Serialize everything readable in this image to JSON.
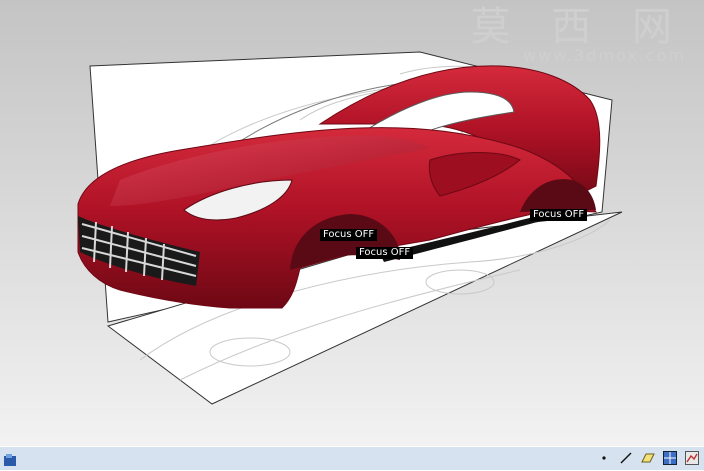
{
  "watermark": {
    "title": "莫 西 网",
    "url": "www.3dmox.com"
  },
  "focus_labels": [
    "Focus OFF",
    "Focus OFF",
    "Focus OFF"
  ],
  "colors": {
    "car_body": "#b01226",
    "background_top": "#c4c4c4",
    "background_bottom": "#f2f2f2",
    "status_bar": "#d6e2ef"
  },
  "statusbar": {
    "left_icon": "app-icon",
    "tools": [
      "dot-icon",
      "line-icon",
      "plane-icon",
      "grid-icon",
      "render-icon"
    ]
  }
}
